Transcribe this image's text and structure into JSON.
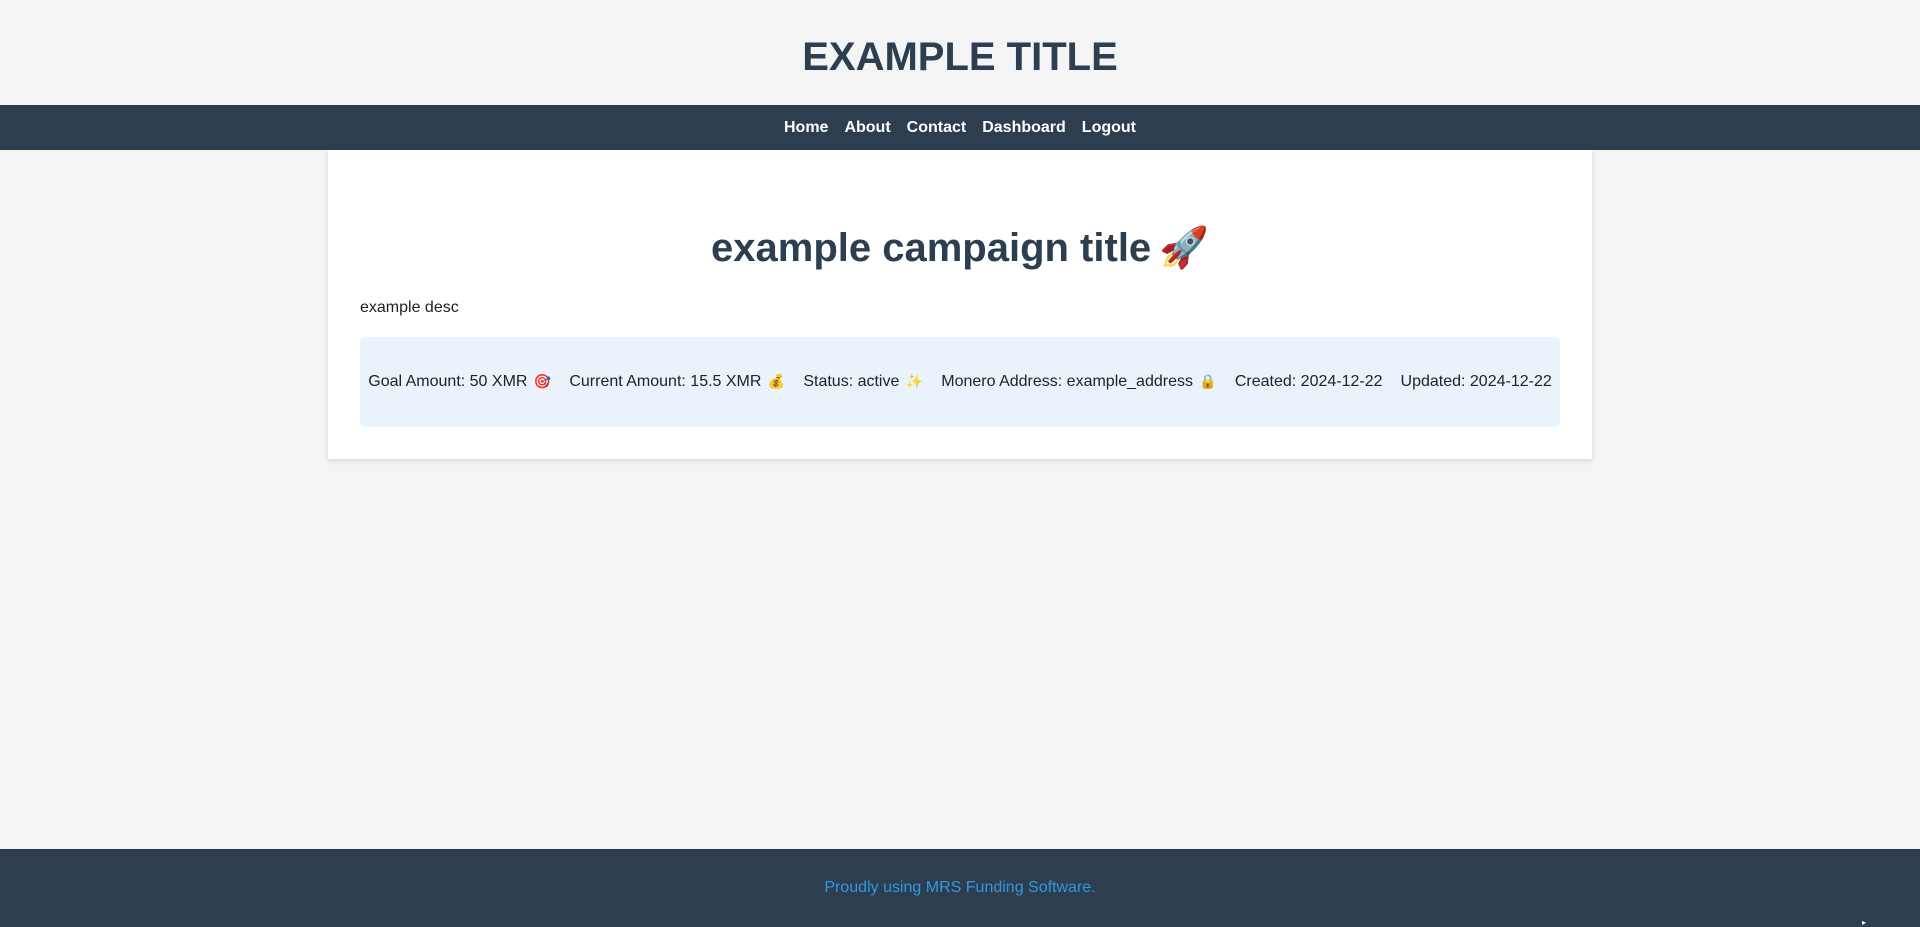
{
  "header": {
    "title": "EXAMPLE TITLE"
  },
  "nav": {
    "items": [
      {
        "label": "Home"
      },
      {
        "label": "About"
      },
      {
        "label": "Contact"
      },
      {
        "label": "Dashboard"
      },
      {
        "label": "Logout"
      }
    ]
  },
  "campaign": {
    "title": "example campaign title",
    "title_emoji": "🚀",
    "description": "example desc",
    "details": [
      {
        "text": "Goal Amount: 50 XMR",
        "emoji": "🎯"
      },
      {
        "text": "Current Amount: 15.5 XMR",
        "emoji": "💰"
      },
      {
        "text": "Status: active",
        "emoji": "✨"
      },
      {
        "text": "Monero Address: example_address",
        "emoji": "🔒"
      },
      {
        "text": "Created: 2024-12-22",
        "emoji": ""
      },
      {
        "text": "Updated: 2024-12-22",
        "emoji": ""
      }
    ]
  },
  "footer": {
    "link_text": "Proudly using MRS Funding Software."
  },
  "colors": {
    "primary_dark": "#2c3e50",
    "background": "#f4f4f4",
    "details_bg": "#eaf3fb",
    "footer_link": "#3498db"
  }
}
